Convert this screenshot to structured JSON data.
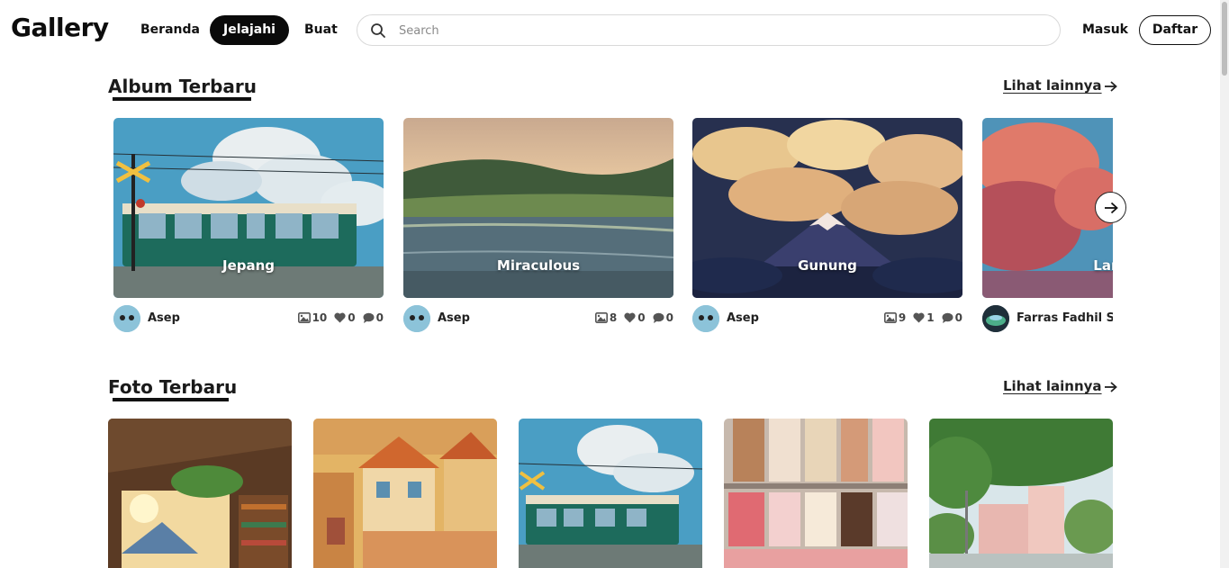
{
  "app": {
    "logo": "Gallery"
  },
  "nav": {
    "beranda": "Beranda",
    "jelajahi": "Jelajahi",
    "buat": "Buat"
  },
  "search": {
    "placeholder": "Search",
    "value": ""
  },
  "auth": {
    "login": "Masuk",
    "register": "Daftar"
  },
  "albums_section": {
    "title": "Album Terbaru",
    "see_more": "Lihat lainnya",
    "items": [
      {
        "name": "Jepang",
        "owner": "Asep",
        "photos": "10",
        "likes": "0",
        "comments": "0"
      },
      {
        "name": "Miraculous",
        "owner": "Asep",
        "photos": "8",
        "likes": "0",
        "comments": "0"
      },
      {
        "name": "Gunung",
        "owner": "Asep",
        "photos": "9",
        "likes": "1",
        "comments": "0"
      },
      {
        "name": "Langit",
        "owner": "Farras Fadhil Syahputra",
        "photos": "",
        "likes": "",
        "comments": ""
      }
    ]
  },
  "photos_section": {
    "title": "Foto Terbaru",
    "see_more": "Lihat lainnya"
  },
  "icons": {
    "search": "search-icon",
    "arrow": "arrow-right-icon",
    "image": "image-icon",
    "heart": "heart-icon",
    "comment": "comment-icon",
    "next": "chevron-right-icon"
  }
}
